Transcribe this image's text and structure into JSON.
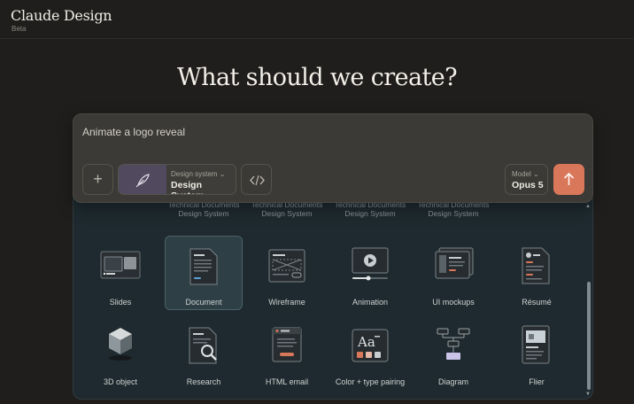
{
  "app": {
    "title": "Claude Design",
    "badge": "Beta"
  },
  "headline": "What should we create?",
  "prompt": {
    "placeholder": "Animate a logo reveal",
    "design_system_label": "Design system",
    "design_system_value": "Design System",
    "model_label": "Model",
    "model_value": "Opus 5"
  },
  "partial_row": [
    "Technical Documents Design System",
    "Technical Documents Design System",
    "Technical Documents Design System",
    "Technical Documents Design System"
  ],
  "gallery": {
    "row1": [
      "Slides",
      "Document",
      "Wireframe",
      "Animation",
      "UI mockups",
      "Résumé"
    ],
    "row2": [
      "3D object",
      "Research",
      "HTML email",
      "Color + type pairing",
      "Diagram",
      "Flier"
    ],
    "selected": "Document"
  },
  "icons": {
    "add": "plus-icon",
    "design_system": "feather-icon",
    "code": "code-icon",
    "send": "arrow-up-icon"
  },
  "colors": {
    "accent": "#d9775a",
    "selected_tile": "#2e3f45",
    "panel": "#1e2a2f"
  }
}
